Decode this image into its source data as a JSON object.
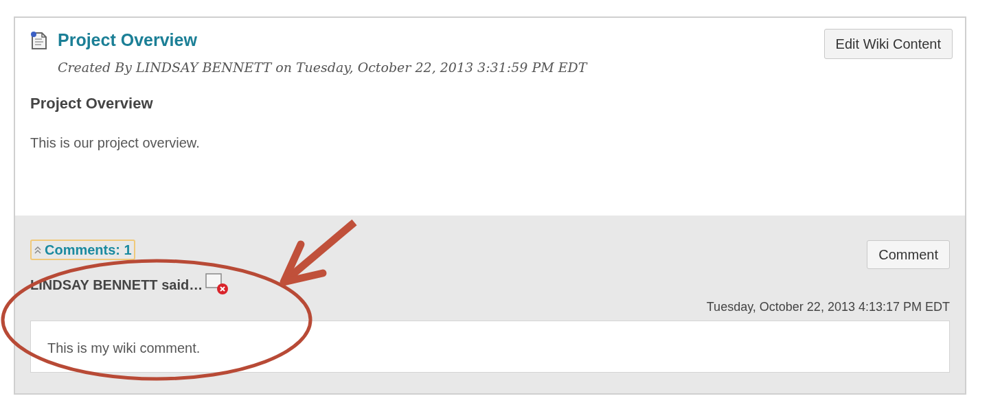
{
  "page": {
    "title": "Project Overview",
    "byline": "Created By LINDSAY BENNETT on Tuesday, October 22, 2013 3:31:59 PM EDT",
    "edit_button": "Edit Wiki Content"
  },
  "content": {
    "heading": "Project Overview",
    "body": "This is our project overview."
  },
  "comments": {
    "toggle": "Comments: 1",
    "expanded": true,
    "comment_button": "Comment",
    "items": [
      {
        "author": "LINDSAY BENNETT said…",
        "timestamp": "Tuesday, October 22, 2013 4:13:17 PM EDT",
        "text": "This is my wiki comment."
      }
    ]
  }
}
